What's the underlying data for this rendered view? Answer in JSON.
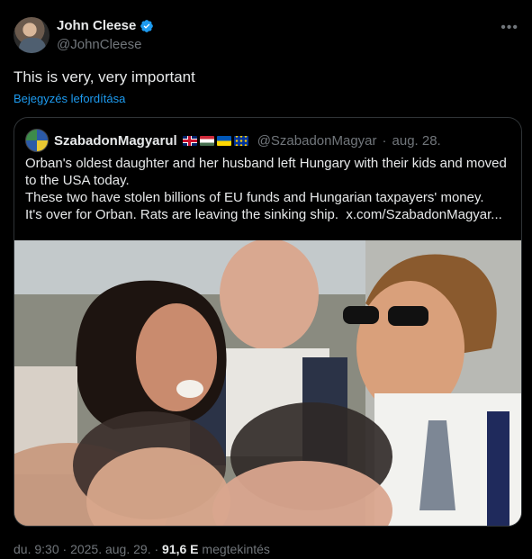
{
  "author": {
    "display_name": "John Cleese",
    "handle": "@JohnCleese"
  },
  "post": {
    "text": "This is very, very important",
    "translate_label": "Bejegyzés lefordítása"
  },
  "quote": {
    "display_name": "SzabadonMagyarul",
    "flags": [
      "uk-flag",
      "hungary-flag",
      "ukraine-flag",
      "eu-flag"
    ],
    "handle": "@SzabadonMagyar",
    "separator": "·",
    "date": "aug. 28.",
    "lines": [
      "Orban's oldest daughter and her husband left Hungary with their kids and moved to the USA today.",
      "These two have stolen billions of EU funds and Hungarian taxpayers' money.",
      "It's over for Orban. Rats are leaving the sinking ship."
    ],
    "link": "x.com/SzabadonMagyar..."
  },
  "meta": {
    "time": "du. 9:30",
    "dot": "·",
    "date": "2025. aug. 29.",
    "views": "91,6 E",
    "views_label": "megtekintés"
  },
  "colors": {
    "background": "#000000",
    "text": "#e7e9ea",
    "secondary": "#71767b",
    "link": "#1d9bf0",
    "border": "#2f3336"
  }
}
